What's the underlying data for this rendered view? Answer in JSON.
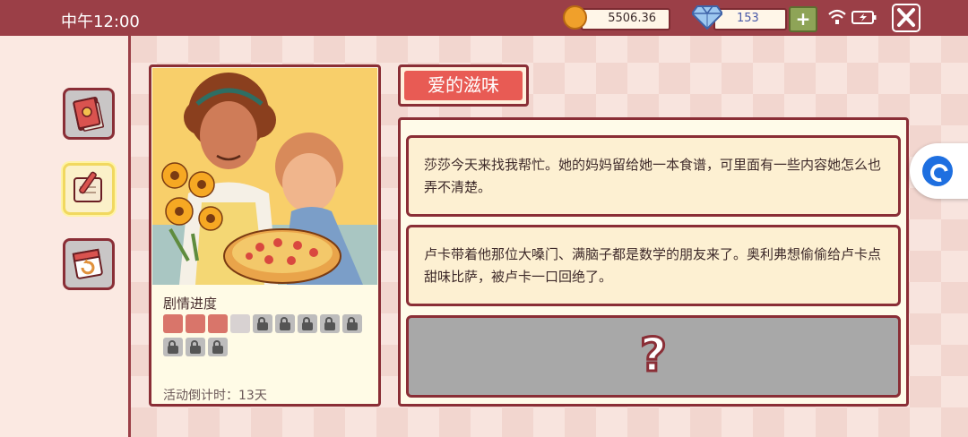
{
  "status_bar": {
    "time": "中午12:00"
  },
  "currency": {
    "coins": "5506.36",
    "gems": "153"
  },
  "icons": [
    "coin-icon",
    "diamond-icon",
    "plus-icon",
    "wifi-icon",
    "battery-icon",
    "close-icon",
    "recipe-book-icon",
    "story-scroll-icon",
    "calendar-refresh-icon",
    "lock-icon",
    "question-mark-icon",
    "floating-assistant-icon"
  ],
  "sidebar": {
    "items": [
      {
        "name": "recipe-book",
        "active": false
      },
      {
        "name": "story-scroll",
        "active": true
      },
      {
        "name": "daily-calendar",
        "active": false
      }
    ]
  },
  "story_card": {
    "progress_title": "剧情进度",
    "progress": {
      "completed": 3,
      "available": 1,
      "locked": 8,
      "total": 12
    },
    "countdown": "活动倒计时：13天"
  },
  "story_panel": {
    "title": "爱的滋味",
    "entries": [
      {
        "text": "莎莎今天来找我帮忙。她的妈妈留给她一本食谱，可里面有一些内容她怎么也弄不清楚。"
      },
      {
        "text": "卢卡带着他那位大嗓门、满脑子都是数学的朋友来了。奥利弗想偷偷给卢卡点甜味比萨，被卢卡一口回绝了。"
      }
    ],
    "locked_entry_symbol": "?"
  },
  "colors": {
    "frame": "#8a2e36",
    "top_bar": "#9b3f47",
    "title_red": "#e85b54",
    "progress_done": "#d9756a",
    "plus_green": "#8ea457"
  }
}
